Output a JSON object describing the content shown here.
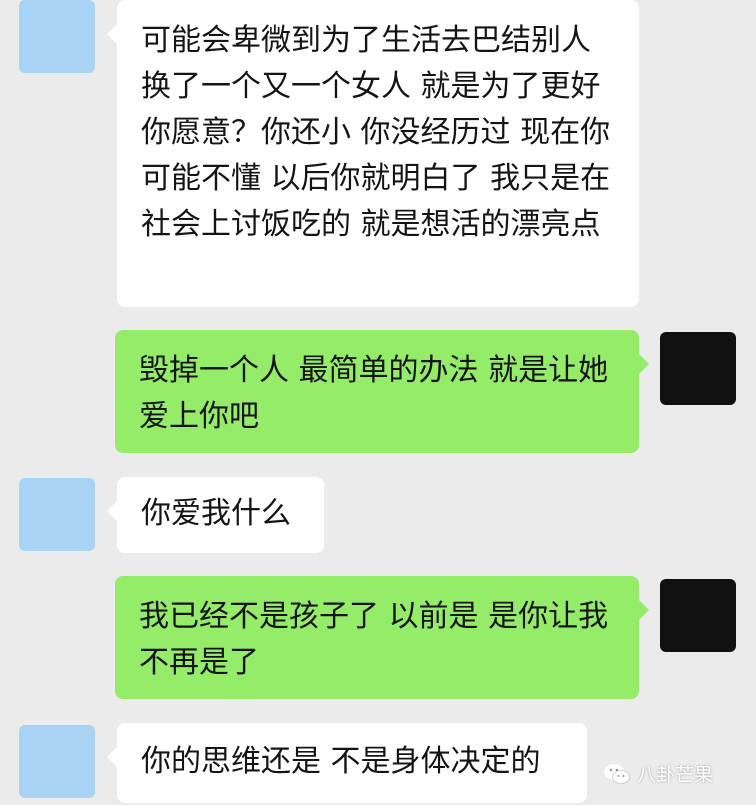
{
  "colors": {
    "background": "#ebebeb",
    "incoming_bubble": "#ffffff",
    "outgoing_bubble": "#95ec69",
    "incoming_avatar": "#a9d3f5",
    "outgoing_avatar": "#111111"
  },
  "messages": [
    {
      "direction": "incoming",
      "text": "可能会卑微到为了生活去巴结别人 换了一个又一个女人 就是为了更好 你愿意？你还小 你没经历过 现在你可能不懂 以后你就明白了 我只是在社会上讨饭吃的 就是想活的漂亮点"
    },
    {
      "direction": "outgoing",
      "text": "毁掉一个人 最简单的办法 就是让她爱上你吧"
    },
    {
      "direction": "incoming",
      "text": "你爱我什么"
    },
    {
      "direction": "outgoing",
      "text": "我已经不是孩子了 以前是 是你让我不再是了"
    },
    {
      "direction": "incoming",
      "text": "你的思维还是 不是身体决定的"
    }
  ],
  "watermark": {
    "text": "八卦芒果",
    "icon": "wechat-icon"
  }
}
